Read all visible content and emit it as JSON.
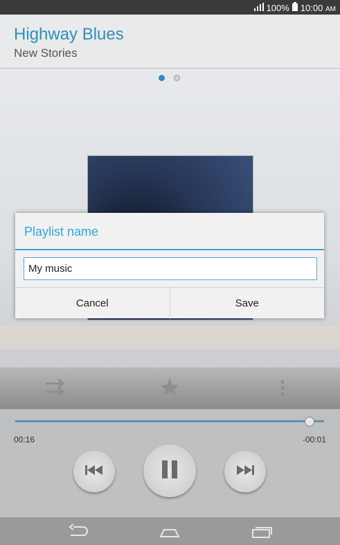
{
  "status_bar": {
    "battery_percent": "100%",
    "time": "10:00",
    "ampm": "AM"
  },
  "header": {
    "track_title": "Highway Blues",
    "artist": "New Stories"
  },
  "pager": {
    "pages": 2,
    "active": 1
  },
  "dialog": {
    "title": "Playlist name",
    "input_value": "My music",
    "cancel_label": "Cancel",
    "save_label": "Save"
  },
  "player": {
    "elapsed": "00:16",
    "remaining": "-00:01",
    "progress": 0.95
  },
  "icons": {
    "shuffle": "shuffle-icon",
    "favorite": "star-icon",
    "more": "more-vertical-icon",
    "prev": "skip-previous-icon",
    "pause": "pause-icon",
    "next": "skip-next-icon",
    "back": "back-icon",
    "home": "home-icon",
    "recent": "recent-apps-icon"
  },
  "colors": {
    "accent": "#31a6d3",
    "title": "#2f8fb8"
  }
}
